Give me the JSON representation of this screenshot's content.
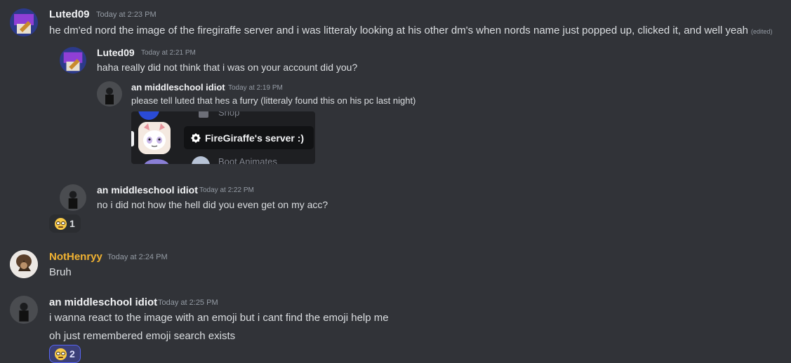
{
  "colors": {
    "background": "#313338",
    "username_yellow": "#f0b232",
    "reaction_active": "#5865f2"
  },
  "messages": [
    {
      "author": "Luted09",
      "timestamp": "Today at 2:23 PM",
      "text": "he dm'ed nord the image of the firegiraffe server and i was litteraly looking at his other dm's when nords name just popped up, clicked it, and well yeah",
      "edited": "(edited)"
    },
    {
      "author": "Luted09",
      "timestamp": "Today at 2:21 PM",
      "text": "haha really did not think that i was on your account did you?"
    },
    {
      "author": "an middleschool idiot",
      "timestamp": "Today at 2:19 PM",
      "text": "please tell luted that hes a furry (litteraly found this on his pc last night)",
      "attachment": {
        "top_label": "Shop",
        "tooltip": "FireGiraffe's server :)",
        "bottom_label": "Boot Animates"
      }
    },
    {
      "author": "an middleschool idiot",
      "timestamp": "Today at 2:22 PM",
      "text": "no i did not how the hell did you even get on my acc?",
      "reaction": {
        "emoji": "nerd-face-emoji",
        "count": "1",
        "active": false
      }
    },
    {
      "author": "NotHenryy",
      "timestamp": "Today at 2:24 PM",
      "text": "Bruh"
    },
    {
      "author": "an middleschool idiot",
      "timestamp": "Today at 2:25 PM",
      "text": "i wanna react to the image with an emoji but i cant find the emoji help me",
      "text2": "oh just remembered emoji search exists",
      "reaction": {
        "emoji": "nerd-face-emoji",
        "count": "2",
        "active": true
      }
    }
  ]
}
